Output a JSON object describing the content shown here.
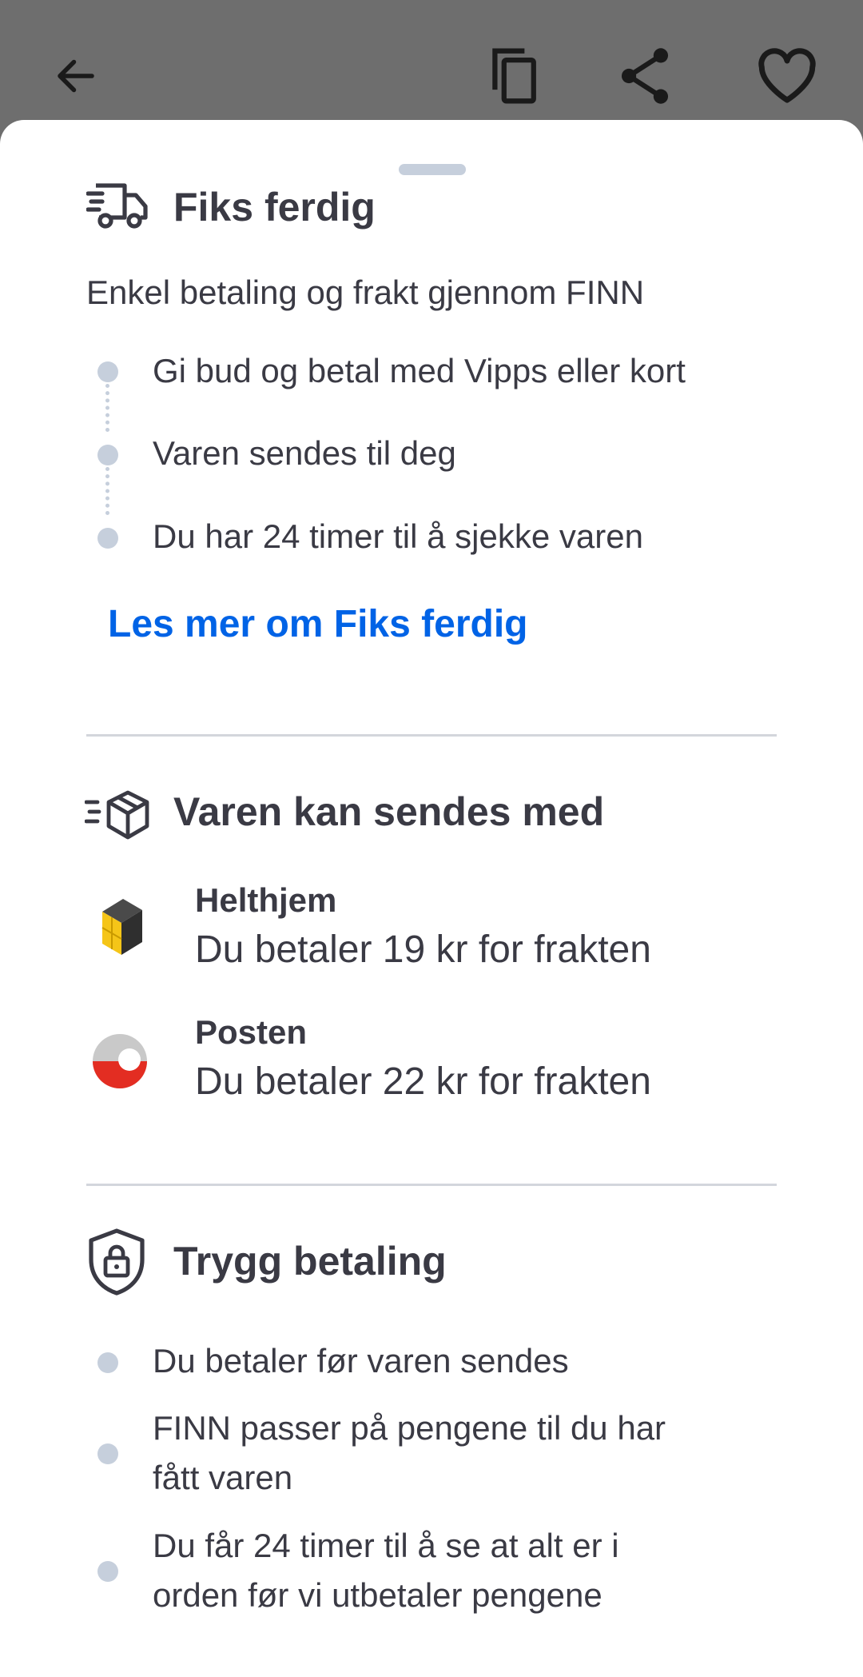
{
  "fiks": {
    "title": "Fiks ferdig",
    "subtitle": "Enkel betaling og frakt gjennom FINN",
    "steps": [
      "Gi bud og betal med Vipps eller kort",
      "Varen sendes til deg",
      "Du har 24 timer til å sjekke varen"
    ],
    "link": "Les mer om Fiks ferdig"
  },
  "shipping": {
    "title": "Varen kan sendes med",
    "carriers": [
      {
        "name": "Helthjem",
        "price": "Du betaler 19 kr for frakten"
      },
      {
        "name": "Posten",
        "price": "Du betaler 22 kr for frakten"
      }
    ]
  },
  "safe": {
    "title": "Trygg betaling",
    "items": [
      {
        "line1": "Du betaler før varen sendes",
        "line2": ""
      },
      {
        "line1": "FINN passer på pengene til du har",
        "line2": "fått varen"
      },
      {
        "line1": "Du får 24 timer til å se at alt er i",
        "line2": "orden før vi utbetaler pengene"
      }
    ]
  },
  "colors": {
    "accent": "#0063e6",
    "bullet": "#c6cfdc",
    "text": "#3a3a44",
    "posten_red": "#e32d22",
    "helthjem_yellow": "#f5c518"
  }
}
